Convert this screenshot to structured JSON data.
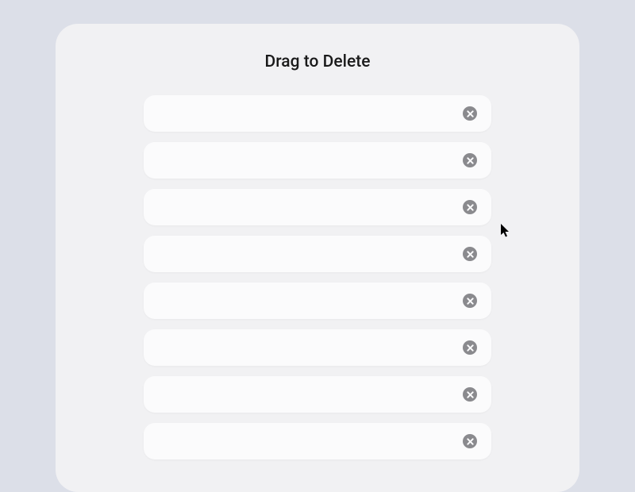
{
  "title": "Drag to Delete",
  "items": [
    {
      "label": ""
    },
    {
      "label": ""
    },
    {
      "label": ""
    },
    {
      "label": ""
    },
    {
      "label": ""
    },
    {
      "label": ""
    },
    {
      "label": ""
    },
    {
      "label": ""
    }
  ],
  "icons": {
    "delete": "close-circle"
  }
}
